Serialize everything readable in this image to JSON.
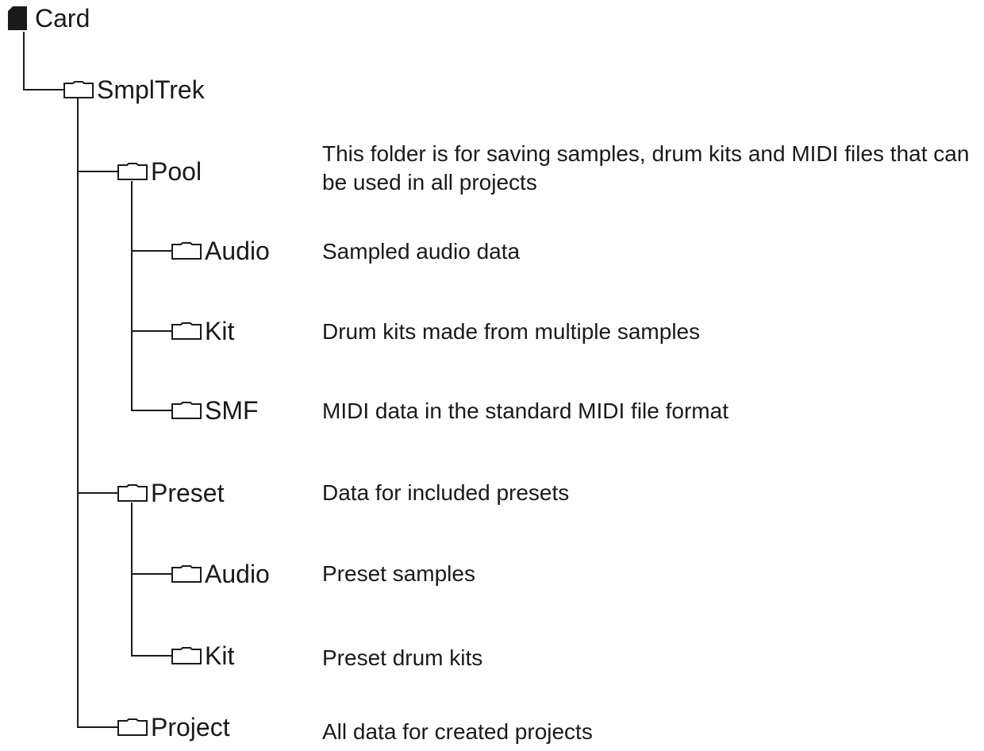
{
  "tree": {
    "root": {
      "label": "Card",
      "icon": "sd-card-icon"
    },
    "smpltrek": {
      "label": "SmplTrek",
      "icon": "folder-icon"
    },
    "pool": {
      "label": "Pool",
      "icon": "folder-icon",
      "description": "This folder is for saving samples, drum kits and MIDI files that can be used in all projects"
    },
    "pool_audio": {
      "label": "Audio",
      "icon": "folder-icon",
      "description": "Sampled audio data"
    },
    "pool_kit": {
      "label": "Kit",
      "icon": "folder-icon",
      "description": "Drum kits made from multiple samples"
    },
    "pool_smf": {
      "label": "SMF",
      "icon": "folder-icon",
      "description": "MIDI data in the standard MIDI file format"
    },
    "preset": {
      "label": "Preset",
      "icon": "folder-icon",
      "description": "Data for included presets"
    },
    "preset_audio": {
      "label": "Audio",
      "icon": "folder-icon",
      "description": "Preset samples"
    },
    "preset_kit": {
      "label": "Kit",
      "icon": "folder-icon",
      "description": "Preset drum kits"
    },
    "project": {
      "label": "Project",
      "icon": "folder-icon",
      "description": "All data for created projects"
    }
  }
}
